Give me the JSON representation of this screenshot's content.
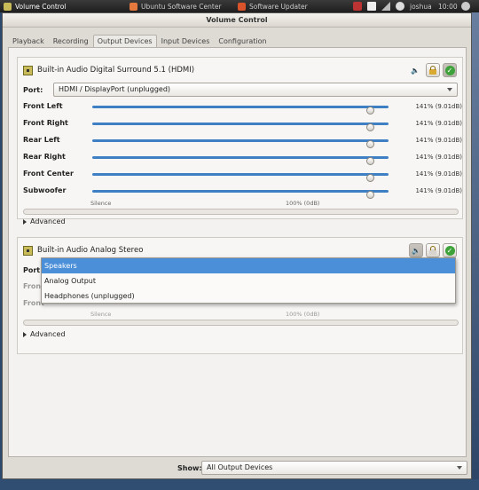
{
  "panel": {
    "tasks": [
      {
        "label": "Volume Control",
        "active": true,
        "icon_color": "#c9bb58"
      },
      {
        "label": "Ubuntu Software Center",
        "active": false,
        "icon_color": "#e5783d"
      },
      {
        "label": "Software Updater",
        "active": false,
        "icon_color": "#d9532b"
      }
    ],
    "user": "joshua",
    "clock": "10:00"
  },
  "window": {
    "title": "Volume Control",
    "tabs": [
      "Playback",
      "Recording",
      "Output Devices",
      "Input Devices",
      "Configuration"
    ],
    "active_tab": "Output Devices"
  },
  "devices": [
    {
      "name": "Built-in Audio Digital Surround 5.1 (HDMI)",
      "port_label": "Port:",
      "port_value": "HDMI / DisplayPort (unplugged)",
      "channels": [
        {
          "label": "Front Left",
          "value": "141% (9.01dB)",
          "level_pct": 141
        },
        {
          "label": "Front Right",
          "value": "141% (9.01dB)",
          "level_pct": 141
        },
        {
          "label": "Rear Left",
          "value": "141% (9.01dB)",
          "level_pct": 141
        },
        {
          "label": "Rear Right",
          "value": "141% (9.01dB)",
          "level_pct": 141
        },
        {
          "label": "Front Center",
          "value": "141% (9.01dB)",
          "level_pct": 141
        },
        {
          "label": "Subwoofer",
          "value": "141% (9.01dB)",
          "level_pct": 141
        }
      ],
      "scale": {
        "min_label": "Silence",
        "mid_label": "100% (0dB)"
      },
      "advanced_label": "Advanced"
    },
    {
      "name": "Built-in Audio Analog Stereo",
      "port_label": "Port:",
      "channels_partial": [
        "Front",
        "Front"
      ],
      "scale": {
        "min_label": "Silence",
        "mid_label": "100% (0dB)"
      },
      "advanced_label": "Advanced"
    }
  ],
  "port_dropdown": {
    "options": [
      "Speakers",
      "Analog Output",
      "Headphones (unplugged)"
    ],
    "selected": "Speakers"
  },
  "footer": {
    "show_label": "Show:",
    "show_value": "All Output Devices"
  },
  "colors": {
    "slider_fill": "#3f7fc4",
    "selection": "#4a8fd8",
    "check": "#3ea23a"
  }
}
